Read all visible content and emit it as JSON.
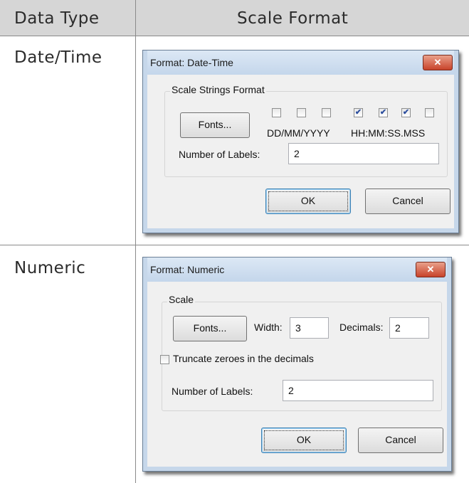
{
  "table": {
    "headers": {
      "data_type": "Data Type",
      "scale_format": "Scale Format"
    },
    "rows": [
      {
        "label": "Date/Time"
      },
      {
        "label": "Numeric"
      }
    ]
  },
  "datetime_dialog": {
    "title": "Format: Date-Time",
    "close_label": "✕",
    "group_label": "Scale Strings Format",
    "fonts_label": "Fonts...",
    "date_checkboxes": [
      false,
      false,
      false
    ],
    "time_checkboxes": [
      true,
      true,
      true,
      false
    ],
    "date_format_label": "DD/MM/YYYY",
    "time_format_label": "HH:MM:SS.MSS",
    "labels_label": "Number of Labels:",
    "labels_value": "2",
    "ok_label": "OK",
    "cancel_label": "Cancel"
  },
  "numeric_dialog": {
    "title": "Format: Numeric",
    "close_label": "✕",
    "group_label": "Scale",
    "fonts_label": "Fonts...",
    "width_label": "Width:",
    "width_value": "3",
    "decimals_label": "Decimals:",
    "decimals_value": "2",
    "truncate_label": "Truncate zeroes in the decimals",
    "truncate_checked": false,
    "labels_label": "Number of Labels:",
    "labels_value": "2",
    "ok_label": "OK",
    "cancel_label": "Cancel"
  },
  "colors": {
    "header_bg": "#d6d6d6",
    "titlebar": "#c4d6eb",
    "close_button": "#c8432a",
    "checkbox_check": "#2d4f9e"
  }
}
